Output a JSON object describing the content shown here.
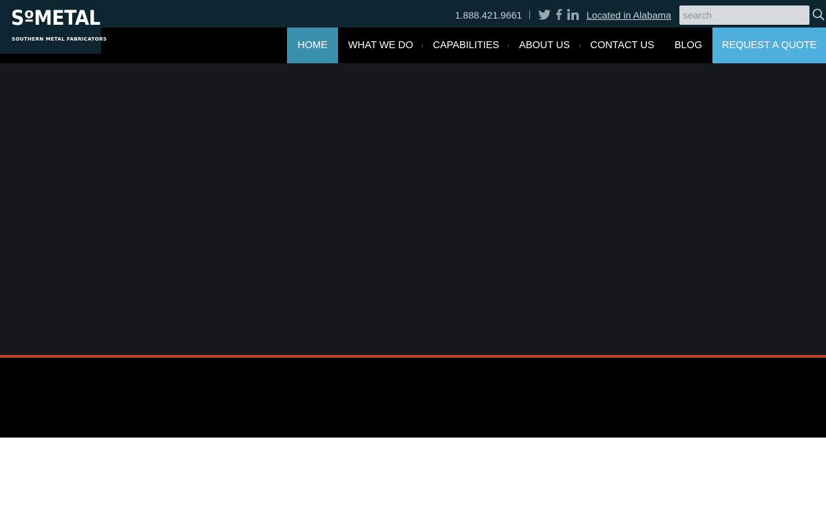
{
  "brand": {
    "name": "SoMETAL",
    "tagline": "SOUTHERN METAL FABRICATORS",
    "logo_display": "SºMETAL"
  },
  "topbar": {
    "phone": "1.888.421.9661",
    "social_icons": [
      "twitter-icon",
      "facebook-icon",
      "linkedin-icon"
    ],
    "location_link": "Located in Alabama",
    "search": {
      "placeholder": "search",
      "value": ""
    }
  },
  "nav": {
    "items": [
      {
        "label": "HOME",
        "active": true
      },
      {
        "label": "WHAT WE DO"
      },
      {
        "label": "CAPABILITIES"
      },
      {
        "label": "ABOUT US"
      },
      {
        "label": "CONTACT US"
      },
      {
        "label": "BLOG"
      }
    ],
    "cta": "REQUEST A QUOTE"
  },
  "colors": {
    "topbar_bg": "#0d2530",
    "nav_bg": "#000000",
    "active_nav": "#3a8fad",
    "cta_bg": "#4fb0dd",
    "hero_bg": "#17181c",
    "accent_line": "#b5452c"
  }
}
